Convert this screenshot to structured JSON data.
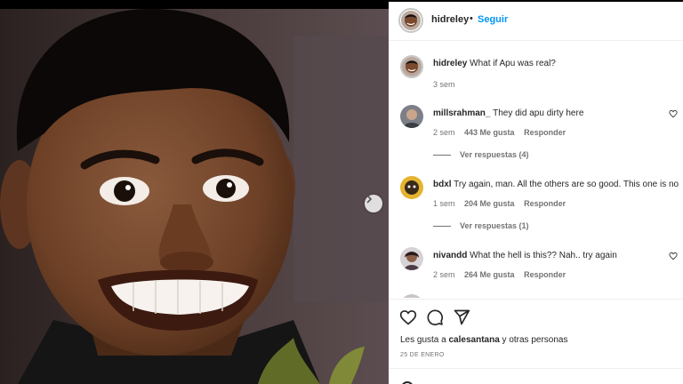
{
  "header": {
    "username": "hidreley",
    "separator": "•",
    "follow_label": "Seguir"
  },
  "caption": {
    "username": "hidreley",
    "text": "What if Apu was real?",
    "time": "3 sem"
  },
  "comments": [
    {
      "username": "millsrahman_",
      "text": "They did apu dirty here",
      "time": "2 sem",
      "likes": "443 Me gusta",
      "reply_label": "Responder",
      "view_replies": "Ver respuestas (4)"
    },
    {
      "username": "bdxl",
      "text": "Try again, man. All the others are so good. This one is no",
      "time": "1 sem",
      "likes": "204 Me gusta",
      "reply_label": "Responder",
      "view_replies": "Ver respuestas (1)"
    },
    {
      "username": "nivandd",
      "text": "What the hell is this?? Nah.. try again",
      "time": "2 sem",
      "likes": "264 Me gusta",
      "reply_label": "Responder"
    }
  ],
  "likes_line": {
    "prefix": "Les gusta a",
    "user": "calesantana",
    "suffix": "y otras personas"
  },
  "date": "25 DE ENERO",
  "icons": {
    "like": "heart-icon",
    "comment": "comment-bubble-icon",
    "share": "paper-plane-icon",
    "carousel_next": "chevron-right-icon"
  },
  "colors": {
    "accent": "#0095f6",
    "text": "#262626",
    "secondary": "#737373"
  }
}
